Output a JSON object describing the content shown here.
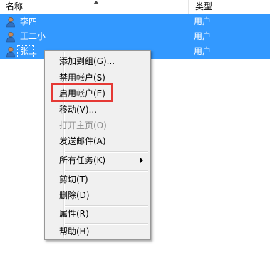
{
  "header": {
    "name_col": "名称",
    "type_col": "类型"
  },
  "rows": [
    {
      "name": "李四",
      "type": "用户",
      "icon": "user-icon"
    },
    {
      "name": "王二小",
      "type": "用户",
      "icon": "user-icon"
    },
    {
      "name": "张三",
      "type": "用户",
      "icon": "user-icon"
    }
  ],
  "menu": {
    "items": [
      {
        "label": "添加到组(G)...",
        "enabled": true
      },
      {
        "label": "禁用帐户(S)",
        "enabled": true
      },
      {
        "label": "启用帐户(E)",
        "enabled": true,
        "highlighted": true
      },
      {
        "label": "移动(V)...",
        "enabled": true
      },
      {
        "label": "打开主页(O)",
        "enabled": false
      },
      {
        "label": "发送邮件(A)",
        "enabled": true
      },
      {
        "label": "所有任务(K)",
        "enabled": true,
        "submenu": true
      },
      {
        "label": "剪切(T)",
        "enabled": true
      },
      {
        "label": "删除(D)",
        "enabled": true
      },
      {
        "label": "属性(R)",
        "enabled": true
      },
      {
        "label": "帮助(H)",
        "enabled": true
      }
    ]
  },
  "colors": {
    "selection": "#3399ff",
    "highlight_box": "#e53935",
    "menu_bg": "#f0f0f0"
  }
}
